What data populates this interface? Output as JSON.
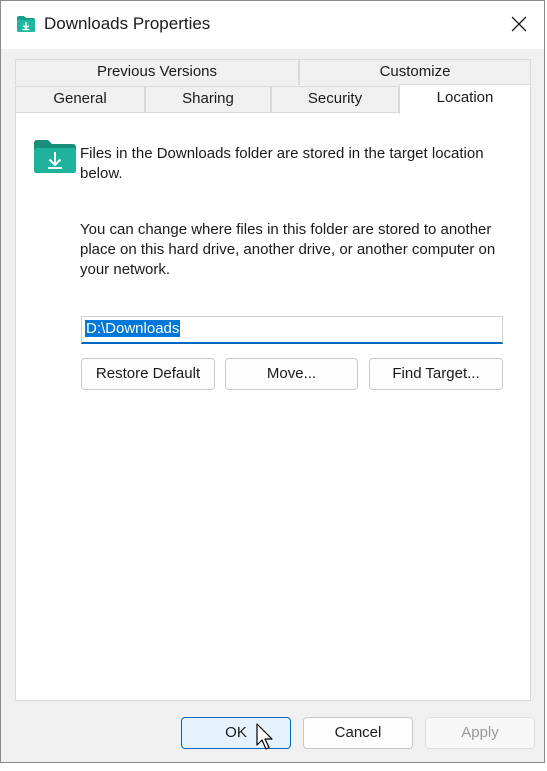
{
  "window": {
    "title": "Downloads Properties",
    "title_icon": "downloads-folder-icon",
    "close_icon": "close-icon"
  },
  "tabs": {
    "row1": [
      "Previous Versions",
      "Customize"
    ],
    "row2": [
      "General",
      "Sharing",
      "Security",
      "Location"
    ],
    "active": "Location"
  },
  "location": {
    "folder_icon": "downloads-folder-icon",
    "info_text": "Files in the Downloads folder are stored in the target location below.",
    "description": "You can change where files in this folder are stored to another place on this hard drive, another drive, or another computer on your network.",
    "path_value": "D:\\Downloads",
    "restore_default_label": "Restore Default",
    "move_label": "Move...",
    "find_target_label": "Find Target..."
  },
  "footer": {
    "ok_label": "OK",
    "cancel_label": "Cancel",
    "apply_label": "Apply"
  },
  "colors": {
    "accent": "#0067c0",
    "selection": "#0078d7",
    "folder_teal": "#1aa08a"
  }
}
